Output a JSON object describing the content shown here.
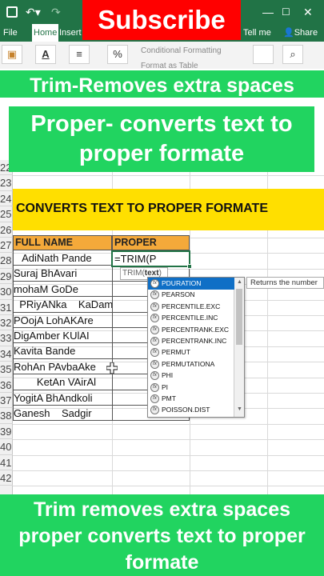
{
  "overlay": {
    "subscribe": "Subscribe",
    "caption_trim": "Trim-Removes extra spaces",
    "caption_proper_line1": "Proper- converts text to",
    "caption_proper_line2": "proper formate",
    "bottom_line1": "Trim removes extra spaces",
    "bottom_line2": "proper converts text to proper",
    "bottom_line3": "formate"
  },
  "tabs": {
    "file": "File",
    "home": "Home",
    "insert": "Insert",
    "tell": "Tell me",
    "share": "Share"
  },
  "ribbon": {
    "conditional_formatting": "Conditional Formatting",
    "format_as_table": "Format as Table",
    "font_letter": "A",
    "percent": "%"
  },
  "sheet": {
    "rows": [
      "22",
      "23",
      "24",
      "25",
      "26",
      "27",
      "28",
      "29",
      "30",
      "31",
      "32",
      "33",
      "34",
      "35",
      "36",
      "37",
      "38",
      "39",
      "40",
      "41",
      "42"
    ],
    "banner": "CONVERTS TEXT TO PROPER FORMATE",
    "header_a": "FULL NAME",
    "header_b": "PROPER NAME",
    "names": [
      "   AdiNath Pande",
      "Suraj BhAvari",
      "mohaM GoDe",
      "  PRiyANka    KaDam",
      "POojA LohAKAre",
      "DigAmber KUlAI",
      "Kavita Bande",
      "RohAn PAvbaAke",
      "        KetAn VAirAl",
      "YogitA BhAndkoli",
      "Ganesh    Sadgir"
    ],
    "formula": "=TRIM(P",
    "tooltip_fn": "TRIM(",
    "tooltip_arg": "text",
    "tooltip_close": ")",
    "description": "Returns the number"
  },
  "autocomplete": [
    "PDURATION",
    "PEARSON",
    "PERCENTILE.EXC",
    "PERCENTILE.INC",
    "PERCENTRANK.EXC",
    "PERCENTRANK.INC",
    "PERMUT",
    "PERMUTATIONA",
    "PHI",
    "PI",
    "PMT",
    "POISSON.DIST"
  ],
  "colors": {
    "excel_green": "#217346",
    "caption_green": "#21d460",
    "subscribe_red": "#ff0000",
    "banner_yellow": "#ffdf00",
    "header_orange": "#f4a93a",
    "selection_blue": "#0f6fc6"
  }
}
